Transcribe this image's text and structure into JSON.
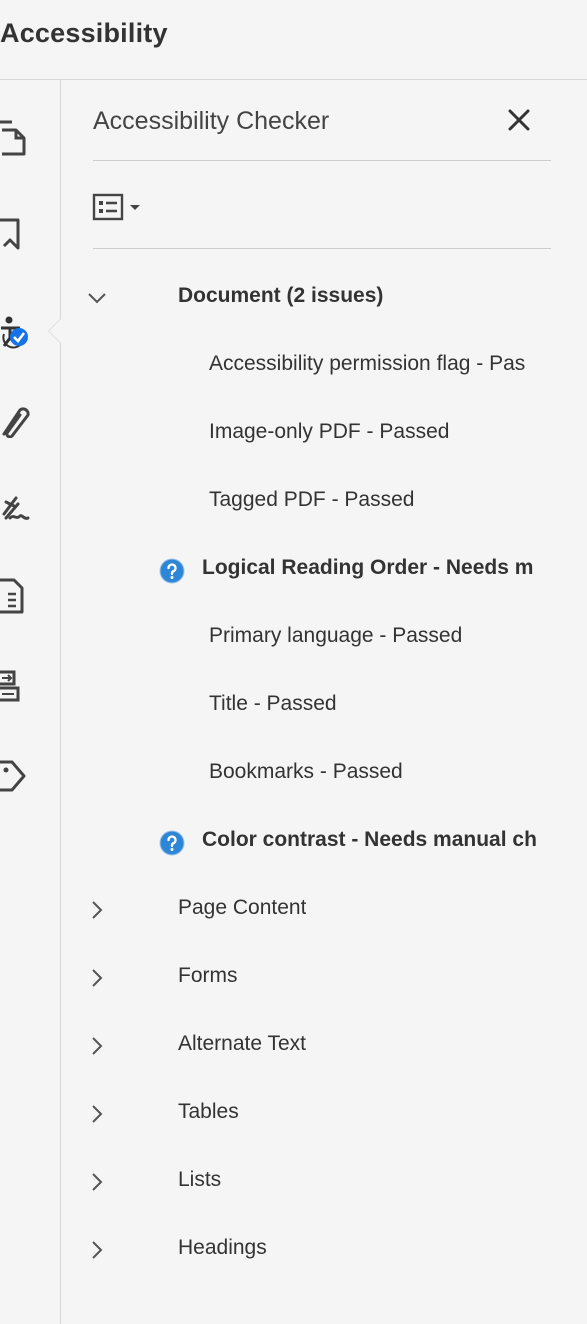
{
  "app": {
    "title": "Accessibility"
  },
  "tool_rail": {
    "items": [
      {
        "icon": "page-thumbnails-icon"
      },
      {
        "icon": "bookmark-icon"
      },
      {
        "icon": "accessibility-check-icon",
        "active": true
      },
      {
        "icon": "attachment-paperclip-icon"
      },
      {
        "icon": "signature-icon"
      },
      {
        "icon": "content-document-icon"
      },
      {
        "icon": "order-pages-icon"
      },
      {
        "icon": "tags-icon"
      }
    ]
  },
  "panel": {
    "title": "Accessibility Checker",
    "close_icon": "close-icon",
    "options_icon": "options-list-icon"
  },
  "tree": {
    "document": {
      "label": "Document (2 issues)",
      "expanded": true,
      "children": [
        {
          "label": "Accessibility permission flag - Pas",
          "status": "passed"
        },
        {
          "label": "Image-only PDF - Passed",
          "status": "passed"
        },
        {
          "label": "Tagged PDF - Passed",
          "status": "passed"
        },
        {
          "label": "Logical Reading Order - Needs m",
          "status": "needs-check"
        },
        {
          "label": "Primary language - Passed",
          "status": "passed"
        },
        {
          "label": "Title - Passed",
          "status": "passed"
        },
        {
          "label": "Bookmarks - Passed",
          "status": "passed"
        },
        {
          "label": "Color contrast - Needs manual ch",
          "status": "needs-check"
        }
      ]
    },
    "categories": [
      {
        "label": "Page Content",
        "expanded": false
      },
      {
        "label": "Forms",
        "expanded": false
      },
      {
        "label": "Alternate Text",
        "expanded": false
      },
      {
        "label": "Tables",
        "expanded": false
      },
      {
        "label": "Lists",
        "expanded": false
      },
      {
        "label": "Headings",
        "expanded": false
      }
    ]
  },
  "colors": {
    "accent_blue": "#1473e6",
    "help_blue": "#2d86d6",
    "text": "#333333",
    "divider": "#cccccc"
  }
}
